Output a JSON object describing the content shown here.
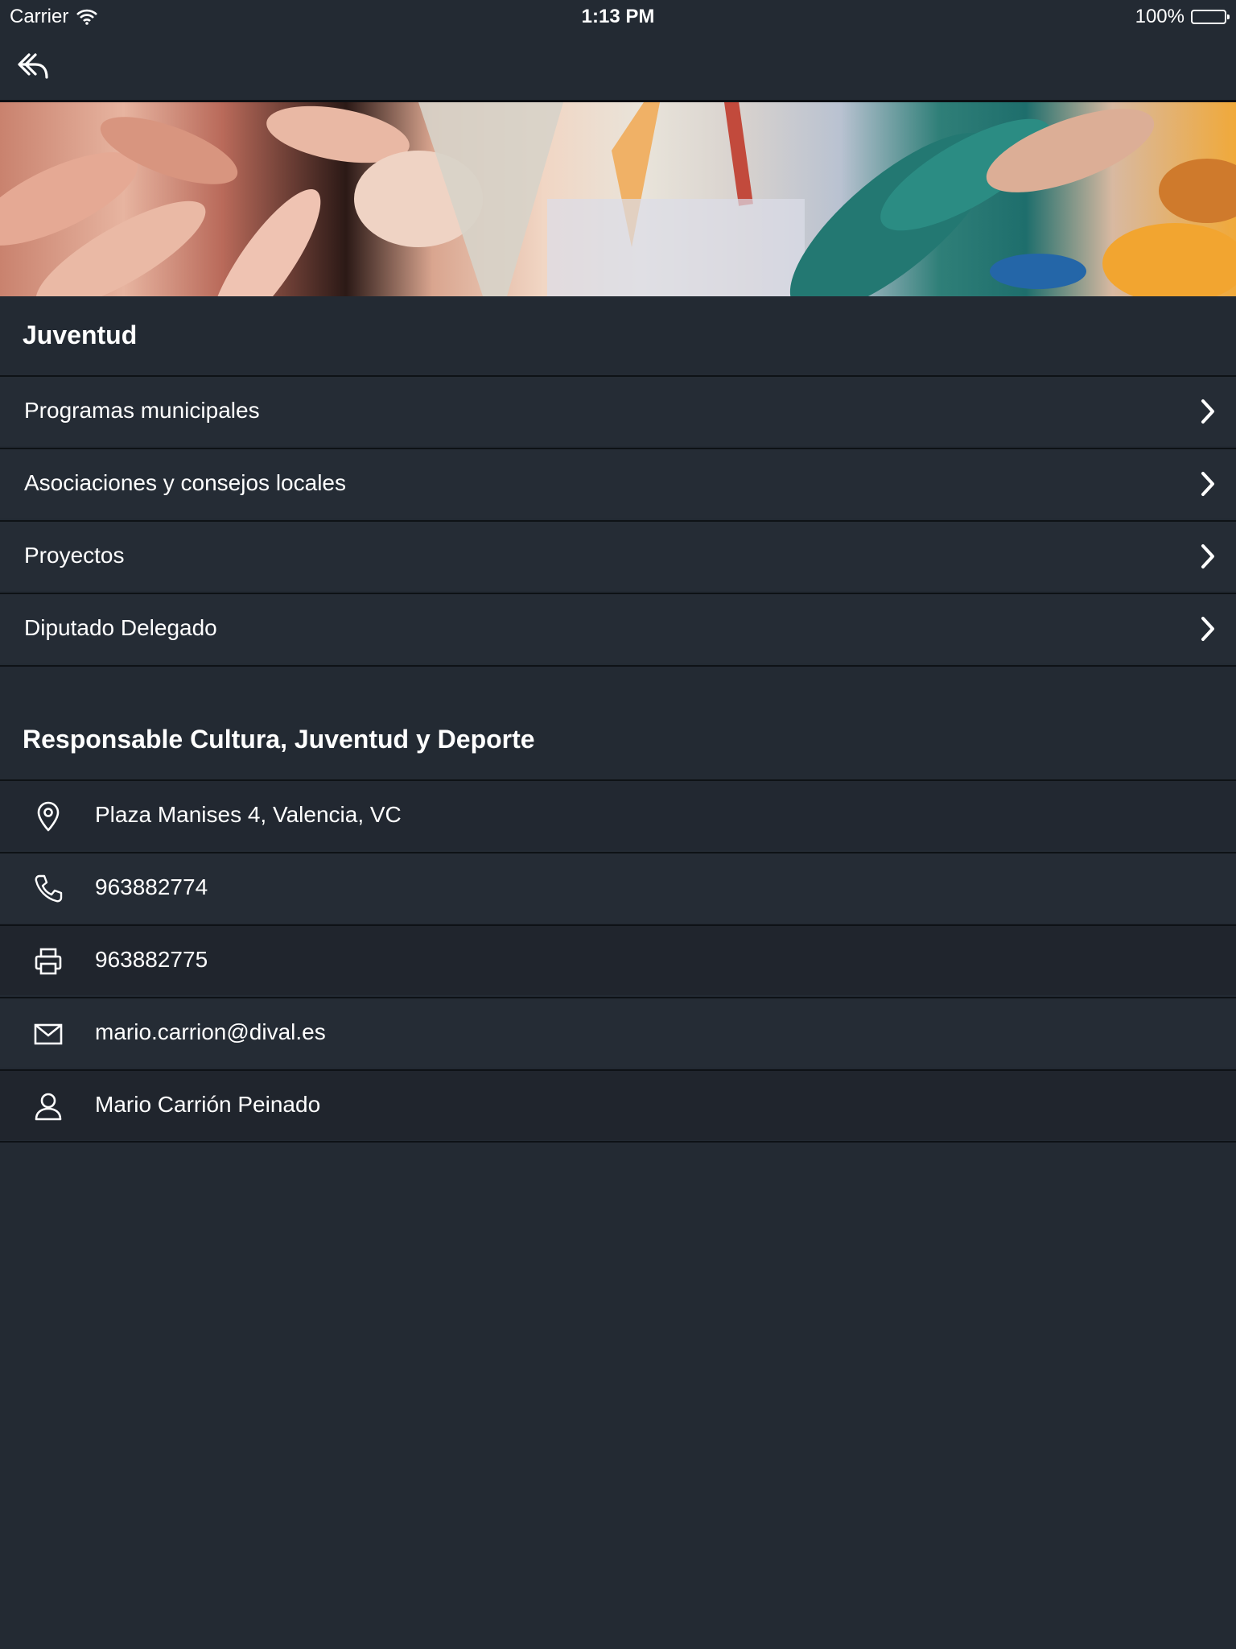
{
  "status_bar": {
    "carrier": "Carrier",
    "time": "1:13 PM",
    "battery": "100%"
  },
  "nav": {
    "back_icon": "reply-back-icon"
  },
  "banner": {
    "description_icon": "banner-image"
  },
  "section": {
    "title": "Juventud",
    "items": [
      {
        "label": "Programas municipales"
      },
      {
        "label": "Asociaciones y consejos locales"
      },
      {
        "label": "Proyectos"
      },
      {
        "label": "Diputado Delegado"
      }
    ]
  },
  "contact": {
    "title": "Responsable Cultura, Juventud y Deporte",
    "address": "Plaza Manises 4, Valencia, VC",
    "phone": "963882774",
    "fax": "963882775",
    "email": "mario.carrion@dival.es",
    "person": "Mario Carrión Peinado"
  },
  "colors": {
    "background": "#232a33",
    "row": "#252c35",
    "divider": "#0e1216"
  }
}
